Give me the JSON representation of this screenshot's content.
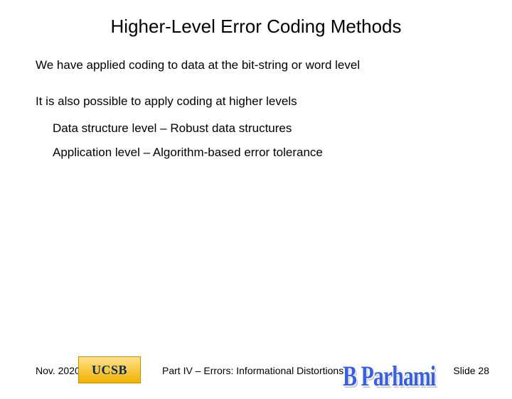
{
  "title": "Higher-Level Error Coding Methods",
  "para1": "We have applied coding to data at the bit-string or word level",
  "para2": "It is also possible to apply coding at higher levels",
  "bullet1": "Data structure level – Robust data structures",
  "bullet2": "Application level – Algorithm-based error tolerance",
  "footer": {
    "date": "Nov. 2020",
    "logo": "UCSB",
    "part": "Part IV – Errors: Informational Distortions",
    "author": "B Parhami",
    "slide": "Slide 28"
  }
}
